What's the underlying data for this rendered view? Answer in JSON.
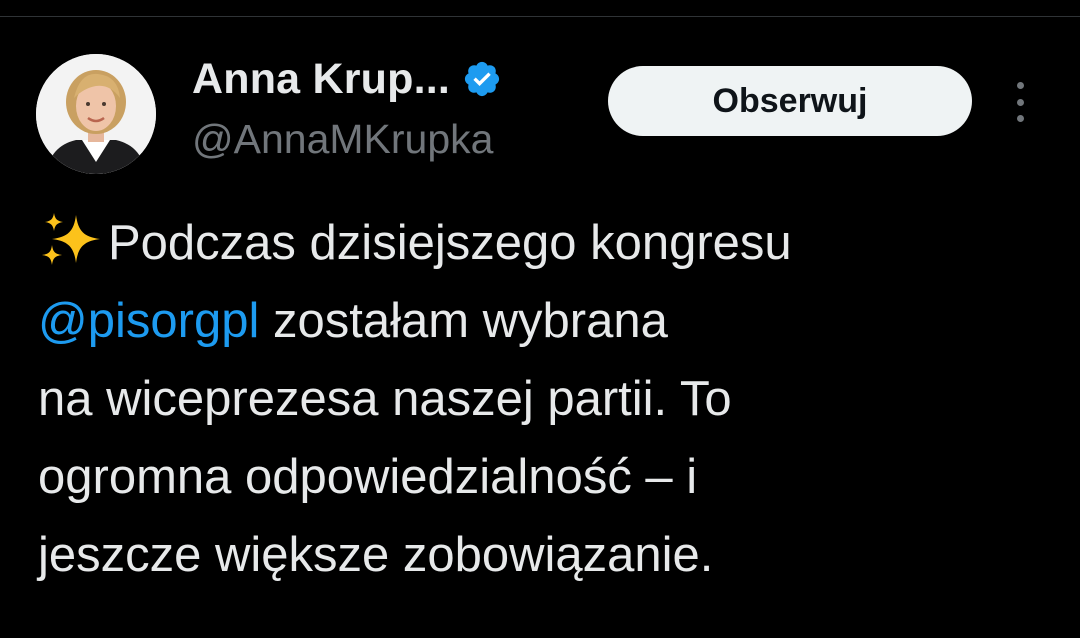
{
  "author": {
    "display_name": "Anna Krup...",
    "handle": "@AnnaMKrupka",
    "verified": true,
    "verified_icon": "verified-badge-icon",
    "avatar": "avatar"
  },
  "follow_button": {
    "label": "Obserwuj"
  },
  "more_menu": {
    "icon": "more-options-icon"
  },
  "tweet": {
    "emoji": "sparkles",
    "line1": "Podczas dzisiejszego kongresu",
    "mention": "@pisorgpl",
    "line2_rest": " zostałam wybrana",
    "line3": "na wiceprezesa naszej partii. To",
    "line4": "ogromna odpowiedzialność – i",
    "line5": "jeszcze większe zobowiązanie."
  },
  "colors": {
    "background": "#000000",
    "text": "#e7e9ea",
    "secondary_text": "#71767b",
    "link": "#1d9bf0",
    "verified": "#1d9bf0",
    "button_bg": "#eff3f4",
    "button_text": "#0f1419"
  }
}
